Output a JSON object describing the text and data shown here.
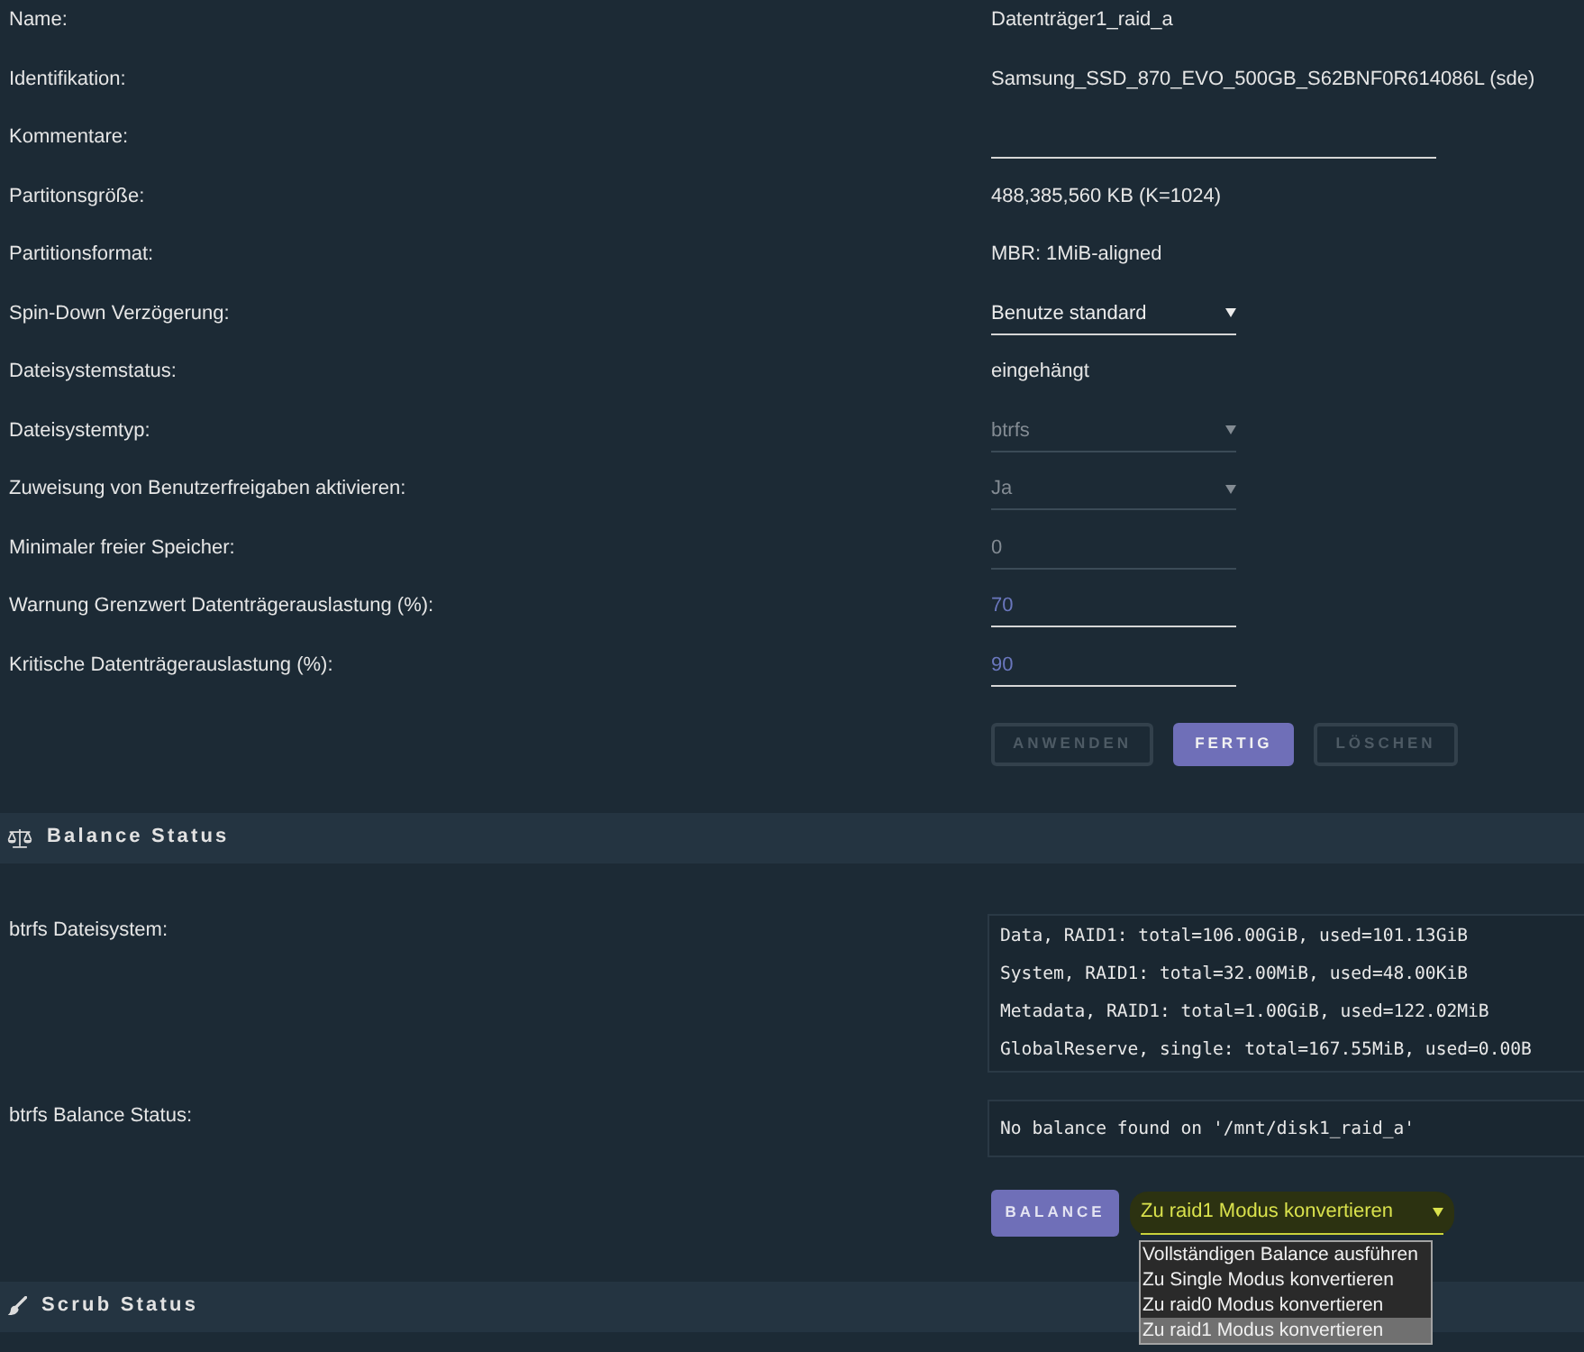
{
  "fields": [
    {
      "kind": "text",
      "label": "Name:",
      "value": "Datenträger1_raid_a"
    },
    {
      "kind": "text",
      "label": "Identifikation:",
      "value": "Samsung_SSD_870_EVO_500GB_S62BNF0R614086L (sde)"
    },
    {
      "kind": "text_input",
      "label": "Kommentare:",
      "disabled": false
    },
    {
      "kind": "text",
      "label": "Partitonsgröße:",
      "value": "488,385,560 KB (K=1024)"
    },
    {
      "kind": "text",
      "label": "Partitionsformat:",
      "value": "MBR: 1MiB-aligned"
    },
    {
      "kind": "select",
      "label": "Spin-Down Verzögerung:",
      "value": "Benutze standard",
      "disabled": false
    },
    {
      "kind": "text",
      "label": "Dateisystemstatus:",
      "value": "eingehängt"
    },
    {
      "kind": "select",
      "label": "Dateisystemtyp:",
      "value": "btrfs",
      "disabled": true
    },
    {
      "kind": "select",
      "label": "Zuweisung von Benutzerfreigaben aktivieren:",
      "value": "Ja",
      "disabled": true
    },
    {
      "kind": "number_input",
      "label": "Minimaler freier Speicher:",
      "value": "0",
      "disabled": true
    },
    {
      "kind": "number_input",
      "label": "Warnung Grenzwert Datenträgerauslastung (%):",
      "value": "70",
      "disabled": false
    },
    {
      "kind": "number_input",
      "label": "Kritische Datenträgerauslastung (%):",
      "value": "90",
      "disabled": false
    }
  ],
  "buttons": [
    {
      "label": "ANWENDEN",
      "disabled": true
    },
    {
      "label": "FERTIG",
      "disabled": false
    },
    {
      "label": "LÖSCHEN",
      "disabled": true
    }
  ],
  "balance": {
    "title": "Balance Status",
    "rows": [
      {
        "label": "btrfs Dateisystem:",
        "lines": [
          "Data, RAID1: total=106.00GiB, used=101.13GiB",
          "System, RAID1: total=32.00MiB, used=48.00KiB",
          "Metadata, RAID1: total=1.00GiB, used=122.02MiB",
          "GlobalReserve, single: total=167.55MiB, used=0.00B"
        ]
      },
      {
        "label": "btrfs Balance Status:",
        "lines": [
          "No balance found on '/mnt/disk1_raid_a'"
        ]
      }
    ],
    "button": "BALANCE",
    "mode_select": {
      "value": "Zu raid1 Modus konvertieren",
      "expanded": true,
      "options": [
        {
          "label": "Vollständigen Balance ausführen",
          "selected": false
        },
        {
          "label": "Zu Single Modus konvertieren",
          "selected": false
        },
        {
          "label": "Zu raid0 Modus konvertieren",
          "selected": false
        },
        {
          "label": "Zu raid1 Modus konvertieren",
          "selected": true
        }
      ]
    }
  },
  "scrub": {
    "title": "Scrub Status"
  }
}
